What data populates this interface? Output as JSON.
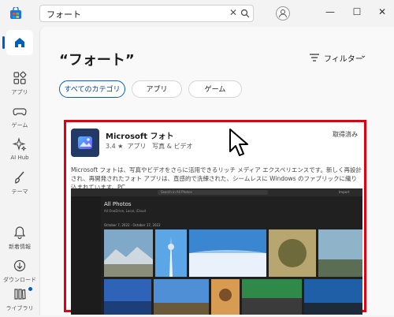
{
  "search": {
    "value": "フォート"
  },
  "window": {
    "minimize": "—",
    "maximize": "☐",
    "close": "✕"
  },
  "sidebar": {
    "items": [
      {
        "label": "ホーム",
        "icon": "home-icon"
      },
      {
        "label": "アプリ",
        "icon": "apps-icon"
      },
      {
        "label": "ゲーム",
        "icon": "gamepad-icon"
      },
      {
        "label": "AI Hub",
        "icon": "sparkle-icon"
      },
      {
        "label": "テーマ",
        "icon": "brush-icon"
      },
      {
        "label": "新着情報",
        "icon": "bell-icon"
      },
      {
        "label": "ダウンロード",
        "icon": "download-icon"
      },
      {
        "label": "ライブラリ",
        "icon": "library-icon"
      }
    ]
  },
  "main": {
    "title": "“フォート”",
    "filter_label": "フィルター",
    "chips": [
      {
        "label": "すべてのカテゴリ"
      },
      {
        "label": "アプリ"
      },
      {
        "label": "ゲーム"
      }
    ]
  },
  "result": {
    "name": "Microsoft フォト",
    "rating": "3.4 ★",
    "type": "アプリ",
    "category": "写真 & ビデオ",
    "status": "取得済み",
    "description": "Microsoft フォトは、写真やビデオをさらに活用できるリッチ メディア エクスペリエンスです。新しく再設計され、再開発されたフォト アプリは、直感的で洗練された、シームレスに Windows のファブリックに織り込まれています。PC...",
    "screenshot": {
      "search_placeholder": "Search in All Photos",
      "import_label": "Import",
      "heading": "All Photos",
      "subtext": "All OneDrive, Local, iCloud",
      "date_range": "October 7, 2022 - October 17, 2022"
    }
  },
  "colors": {
    "accent": "#005fb8",
    "highlight_border": "#e00012"
  }
}
